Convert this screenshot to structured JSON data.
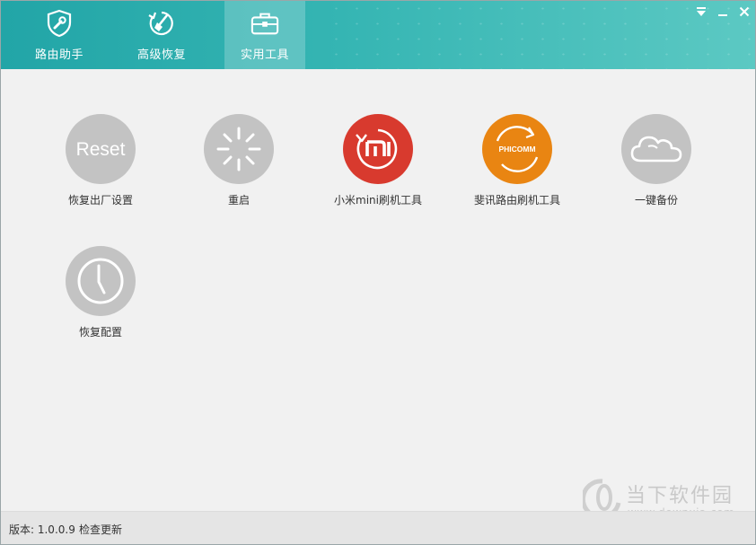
{
  "tabs": [
    {
      "label": "路由助手",
      "icon": "shield-wrench-icon"
    },
    {
      "label": "高级恢复",
      "icon": "broom-refresh-icon"
    },
    {
      "label": "实用工具",
      "icon": "toolbox-icon"
    }
  ],
  "active_tab": "实用工具",
  "window_controls": {
    "menu": "menu-icon",
    "minimize": "minimize-icon",
    "close": "close-icon"
  },
  "tools": [
    {
      "label": "恢复出厂设置",
      "icon": "reset-icon",
      "icon_text": "Reset",
      "color": "#c3c3c3"
    },
    {
      "label": "重启",
      "icon": "restart-spinner-icon",
      "color": "#c3c3c3"
    },
    {
      "label": "小米mini刷机工具",
      "icon": "xiaomi-flash-icon",
      "color": "#d83a2e"
    },
    {
      "label": "斐讯路由刷机工具",
      "icon": "phicomm-flash-icon",
      "icon_text": "PHICOMM",
      "color": "#e98512"
    },
    {
      "label": "一键备份",
      "icon": "cloud-backup-icon",
      "color": "#c3c3c3"
    },
    {
      "label": "恢复配置",
      "icon": "clock-restore-icon",
      "color": "#c3c3c3"
    }
  ],
  "footer": {
    "version": "版本: 1.0.0.9",
    "update_link": "检查更新"
  },
  "watermark": {
    "name": "当下软件园",
    "url": "www.downxia.com"
  },
  "colors": {
    "header_start": "#22a5a7",
    "header_end": "#5cc9c3",
    "background": "#f1f1f1",
    "icon_gray": "#c3c3c3",
    "xiaomi_red": "#d83a2e",
    "phicomm_orange": "#e98512"
  }
}
